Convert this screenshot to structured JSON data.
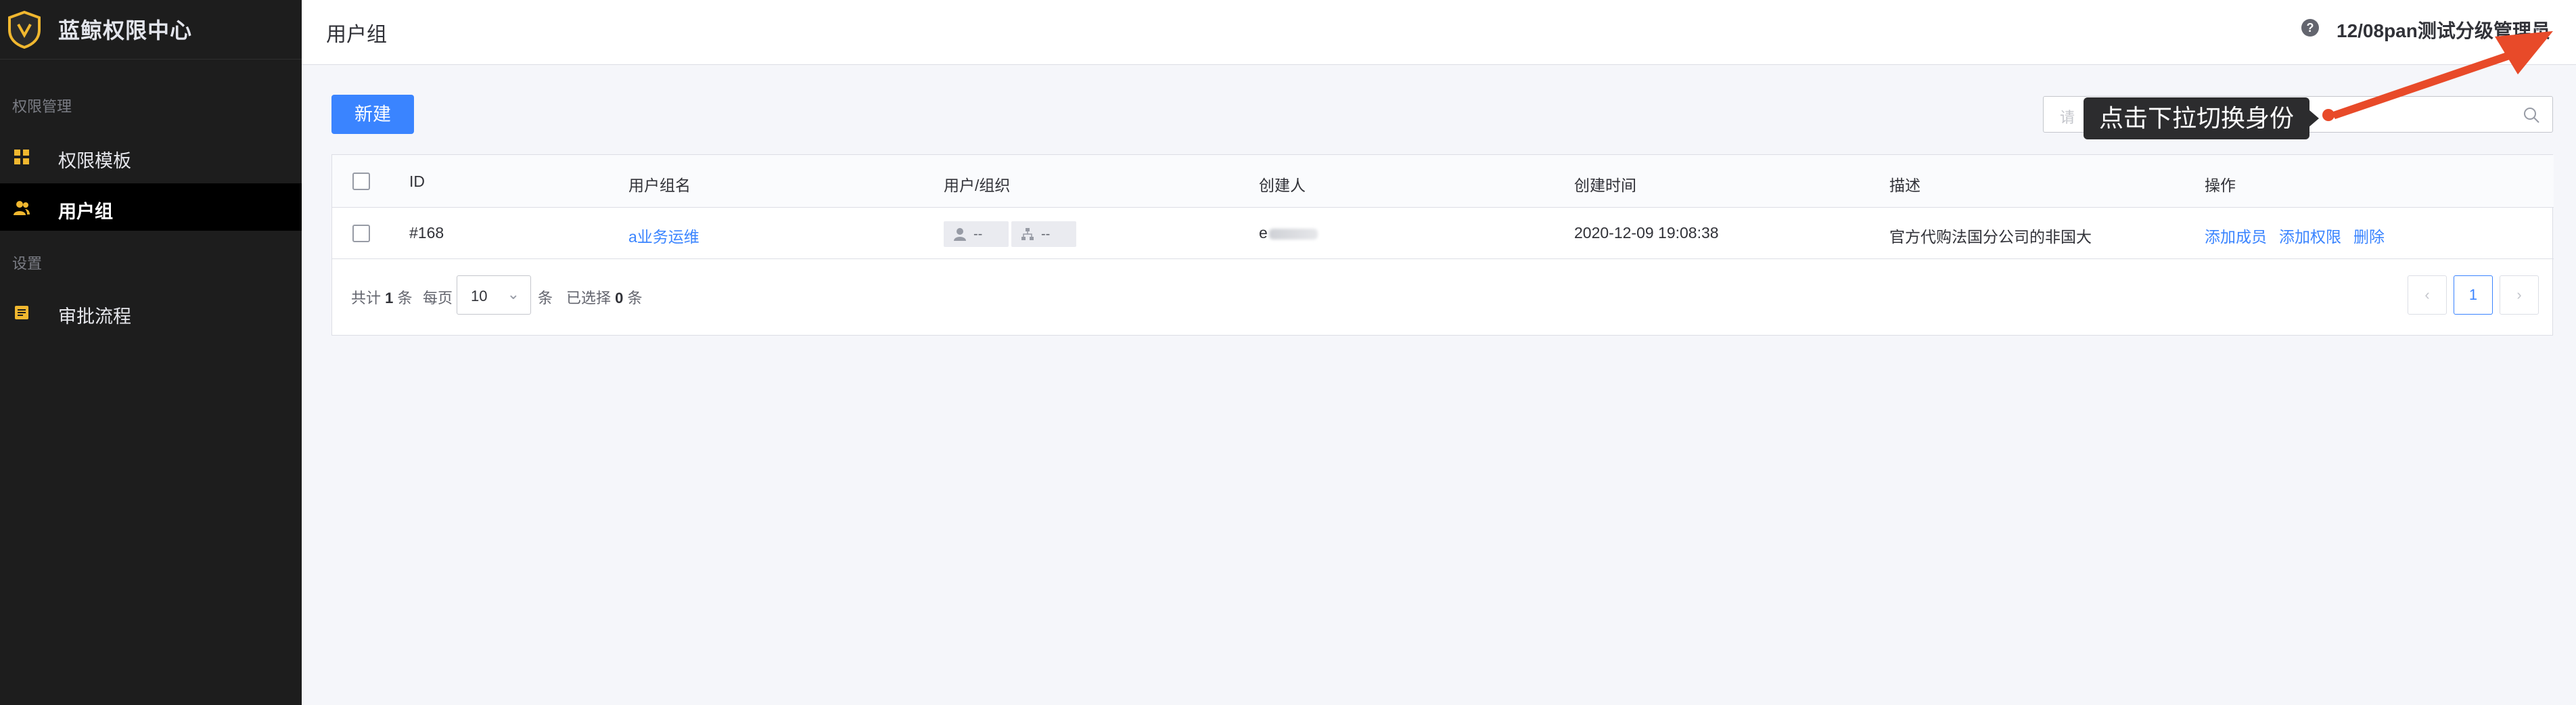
{
  "app": {
    "title": "蓝鲸权限中心"
  },
  "sidebar": {
    "groups": [
      {
        "label": "权限管理",
        "items": [
          {
            "label": "权限模板",
            "icon": "grid-icon"
          },
          {
            "label": "用户组",
            "icon": "users-icon"
          }
        ]
      },
      {
        "label": "设置",
        "items": [
          {
            "label": "审批流程",
            "icon": "list-icon"
          }
        ]
      }
    ],
    "active": "用户组"
  },
  "header": {
    "title": "用户组",
    "help": "?",
    "user": "12/08pan测试分级管理员",
    "caret": "⌄"
  },
  "toolbar": {
    "new_label": "新建",
    "search_placeholder": "请"
  },
  "table": {
    "columns": [
      "ID",
      "用户组名",
      "用户/组织",
      "创建人",
      "创建时间",
      "描述",
      "操作"
    ],
    "rows": [
      {
        "id": "#168",
        "name": "a业务运维",
        "users": "--",
        "orgs": "--",
        "creator": "e",
        "created_at": "2020-12-09 19:08:38",
        "description": "官方代购法国分公司的非国大",
        "actions": [
          "添加成员",
          "添加权限",
          "删除"
        ]
      }
    ]
  },
  "pagination": {
    "total_prefix": "共计",
    "total": "1",
    "total_suffix": "条",
    "per_page_label": "每页",
    "page_size": "10",
    "per_page_suffix": "条",
    "selected_prefix": "已选择",
    "selected": "0",
    "selected_suffix": "条",
    "prev": "‹",
    "current": "1",
    "next": "›"
  },
  "annotation": {
    "tooltip": "点击下拉切换身份",
    "accent": "#e84a29"
  },
  "colors": {
    "primary": "#3a84ff",
    "sidebar_bg": "#1d1d1d",
    "logo": "#f0b72f"
  }
}
